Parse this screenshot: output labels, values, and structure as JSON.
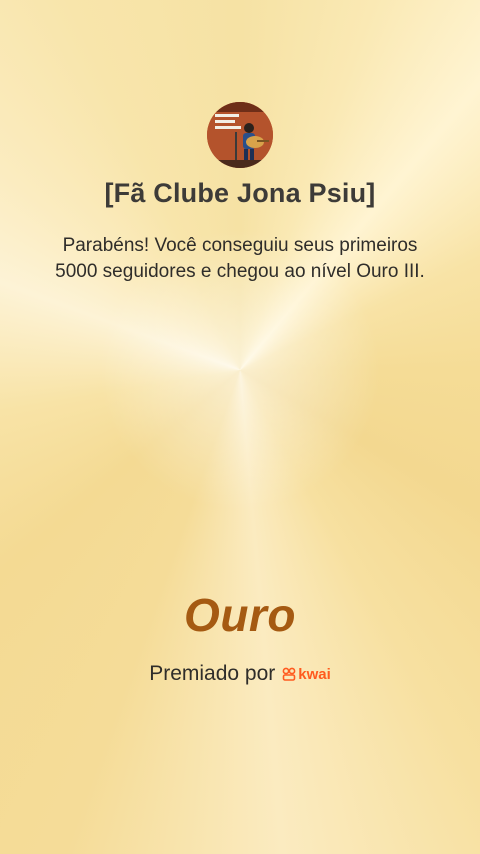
{
  "club": {
    "name": "[Fã Clube Jona Psiu]",
    "avatar_alt": "Jona Psiu"
  },
  "message": "Parabéns! Você conseguiu seus primeiros 5000 seguidores e chegou ao nível Ouro III.",
  "level": "Ouro",
  "awarded": {
    "label": "Premiado por",
    "brand": "kwai",
    "brand_icon": "kwai-logo-icon"
  },
  "colors": {
    "level": "#a55a12",
    "brand": "#ff5a1f"
  }
}
